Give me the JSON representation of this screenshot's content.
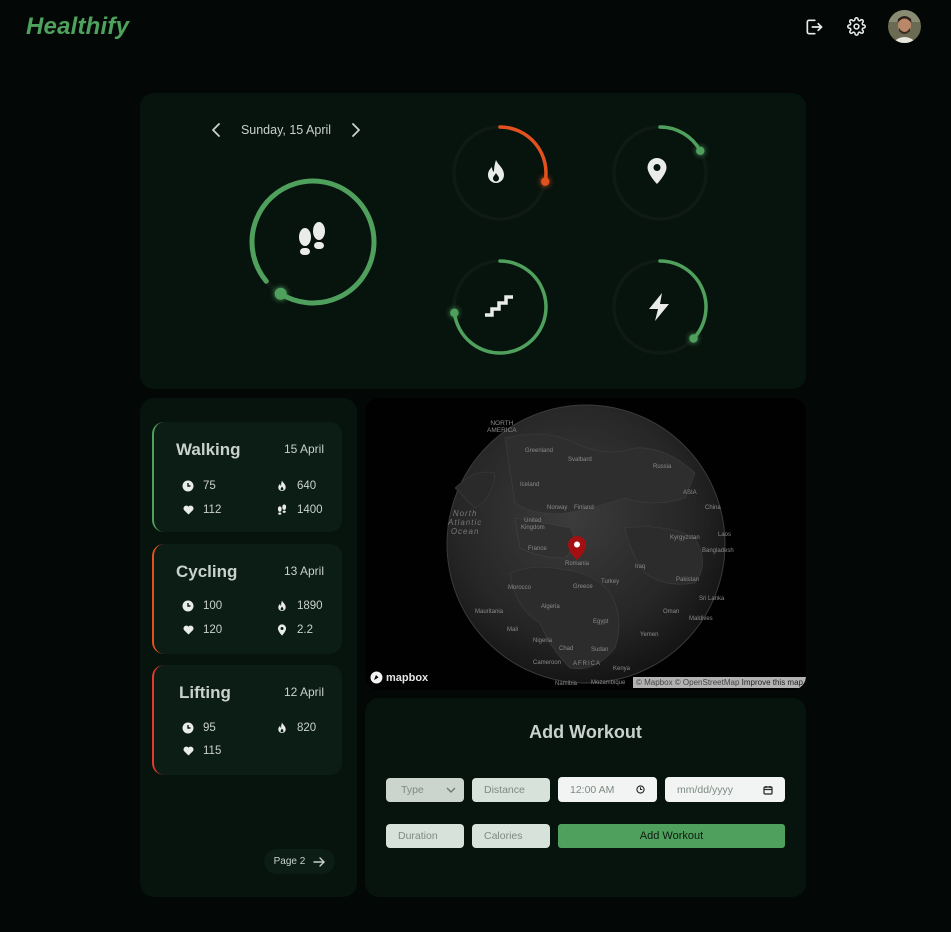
{
  "app": {
    "brand": "Healthify"
  },
  "header": {
    "icons": [
      "logout-icon",
      "settings-gear-icon",
      "user-avatar"
    ]
  },
  "colors": {
    "accent": "#4fa05d",
    "calories": "#e2521e",
    "card": "#0b1d14",
    "panel": "#07130d",
    "background": "#030806"
  },
  "stats": {
    "date": "Sunday, 15 April",
    "rings": [
      {
        "name": "steps",
        "icon": "footprints-icon",
        "progress": 0.95
      },
      {
        "name": "calories",
        "icon": "flame-icon",
        "progress": 0.28
      },
      {
        "name": "distance",
        "icon": "location-pin-icon",
        "progress": 0.17
      },
      {
        "name": "floors",
        "icon": "stairs-icon",
        "progress": 0.73
      },
      {
        "name": "energy",
        "icon": "lightning-icon",
        "progress": 0.37
      }
    ]
  },
  "history": {
    "workouts": [
      {
        "title": "Walking",
        "date": "15 April",
        "accent": "#4fa05d",
        "stats": [
          {
            "icon": "clock-icon",
            "value": "75"
          },
          {
            "icon": "flame-icon",
            "value": "640"
          },
          {
            "icon": "heart-icon",
            "value": "112"
          },
          {
            "icon": "footprints-icon",
            "value": "1400"
          }
        ]
      },
      {
        "title": "Cycling",
        "date": "13 April",
        "accent": "#e2521e",
        "stats": [
          {
            "icon": "clock-icon",
            "value": "100"
          },
          {
            "icon": "flame-icon",
            "value": "1890"
          },
          {
            "icon": "heart-icon",
            "value": "120"
          },
          {
            "icon": "location-pin-icon",
            "value": "2.2"
          }
        ]
      },
      {
        "title": "Lifting",
        "date": "12 April",
        "accent": "#e23b2e",
        "stats": [
          {
            "icon": "clock-icon",
            "value": "95"
          },
          {
            "icon": "flame-icon",
            "value": "820"
          },
          {
            "icon": "heart-icon",
            "value": "115"
          }
        ]
      }
    ],
    "pager": {
      "label": "Page 2"
    }
  },
  "map": {
    "logo": "mapbox",
    "attribution": "© Mapbox © OpenStreetMap",
    "improve": "Improve this map",
    "labels": {
      "north_america": "NORTH\nAMERICA",
      "greenland": "Greenland",
      "svalbard": "Svalbard",
      "russia": "Russia",
      "iceland": "Iceland",
      "asia": "ASIA",
      "ocean": "North\nAtlantic\nOcean",
      "norway": "Norway",
      "finland": "Finland",
      "uk": "United\nKingdom",
      "china": "China",
      "kyrgyzstan": "Kyrgyzstan",
      "laos": "Laos",
      "bangladesh": "Bangladesh",
      "france": "France",
      "romania": "Romania",
      "iraq": "Iraq",
      "pakistan": "Pakistan",
      "morocco": "Morocco",
      "greece": "Greece",
      "turkey": "Turkey",
      "sri_lanka": "Sri Lanka",
      "algeria": "Algeria",
      "mauritania": "Mauritania",
      "oman": "Oman",
      "maldives": "Maldives",
      "mali": "Mali",
      "egypt": "Egypt",
      "yemen": "Yemen",
      "nigeria": "Nigeria",
      "chad": "Chad",
      "sudan": "Sudan",
      "africa": "AFRICA",
      "cameroon": "Cameroon",
      "kenya": "Kenya",
      "namibia": "Namibia",
      "mozambique": "Mozambique"
    }
  },
  "form": {
    "title": "Add Workout",
    "type_placeholder": "Type",
    "distance_placeholder": "Distance",
    "time_value": "12:00 AM",
    "date_placeholder": "mm/dd/yyyy",
    "duration_placeholder": "Duration",
    "calories_placeholder": "Calories",
    "submit_label": "Add Workout"
  }
}
